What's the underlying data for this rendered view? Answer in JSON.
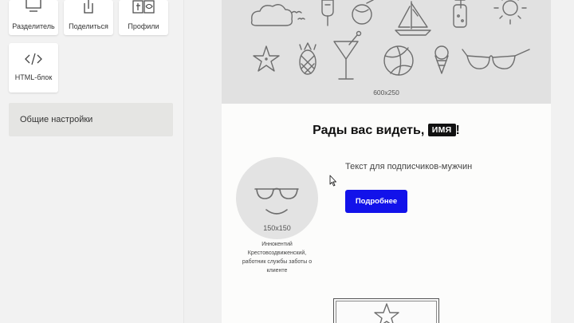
{
  "left_panel": {
    "blocks": [
      {
        "label": "Разделитель",
        "icon": "divider-icon"
      },
      {
        "label": "Поделиться",
        "icon": "share-icon"
      },
      {
        "label": "Профили",
        "icon": "social-profiles-icon"
      },
      {
        "label": "HTML-блок",
        "icon": "code-icon"
      }
    ],
    "general_settings": "Общие настройки"
  },
  "email": {
    "banner": {
      "size_label": "600x250",
      "icons": [
        "cloud-icon",
        "birds-icon",
        "popsicle-icon",
        "coconut-icon",
        "sailboat-icon",
        "drink-jar-icon",
        "sun-icon",
        "starfish-icon",
        "pineapple-icon",
        "cocktail-icon",
        "beach-ball-icon",
        "ice-cream-icon",
        "sunglasses-icon"
      ]
    },
    "greeting": {
      "text": "Рады вас видеть,",
      "name_tag": "ИМЯ",
      "punctuation": "!"
    },
    "avatar": {
      "size_label": "150x150",
      "caption": "Иннокентий Крестовоздвиженский, работник службы заботы о клиенте"
    },
    "subscriber_text": "Текст для подписчиков-мужчин",
    "more_button": "Подробнее"
  },
  "colors": {
    "accent_button": "#1212ea",
    "name_tag_bg": "#111111",
    "banner_bg": "#e1e1e1"
  }
}
